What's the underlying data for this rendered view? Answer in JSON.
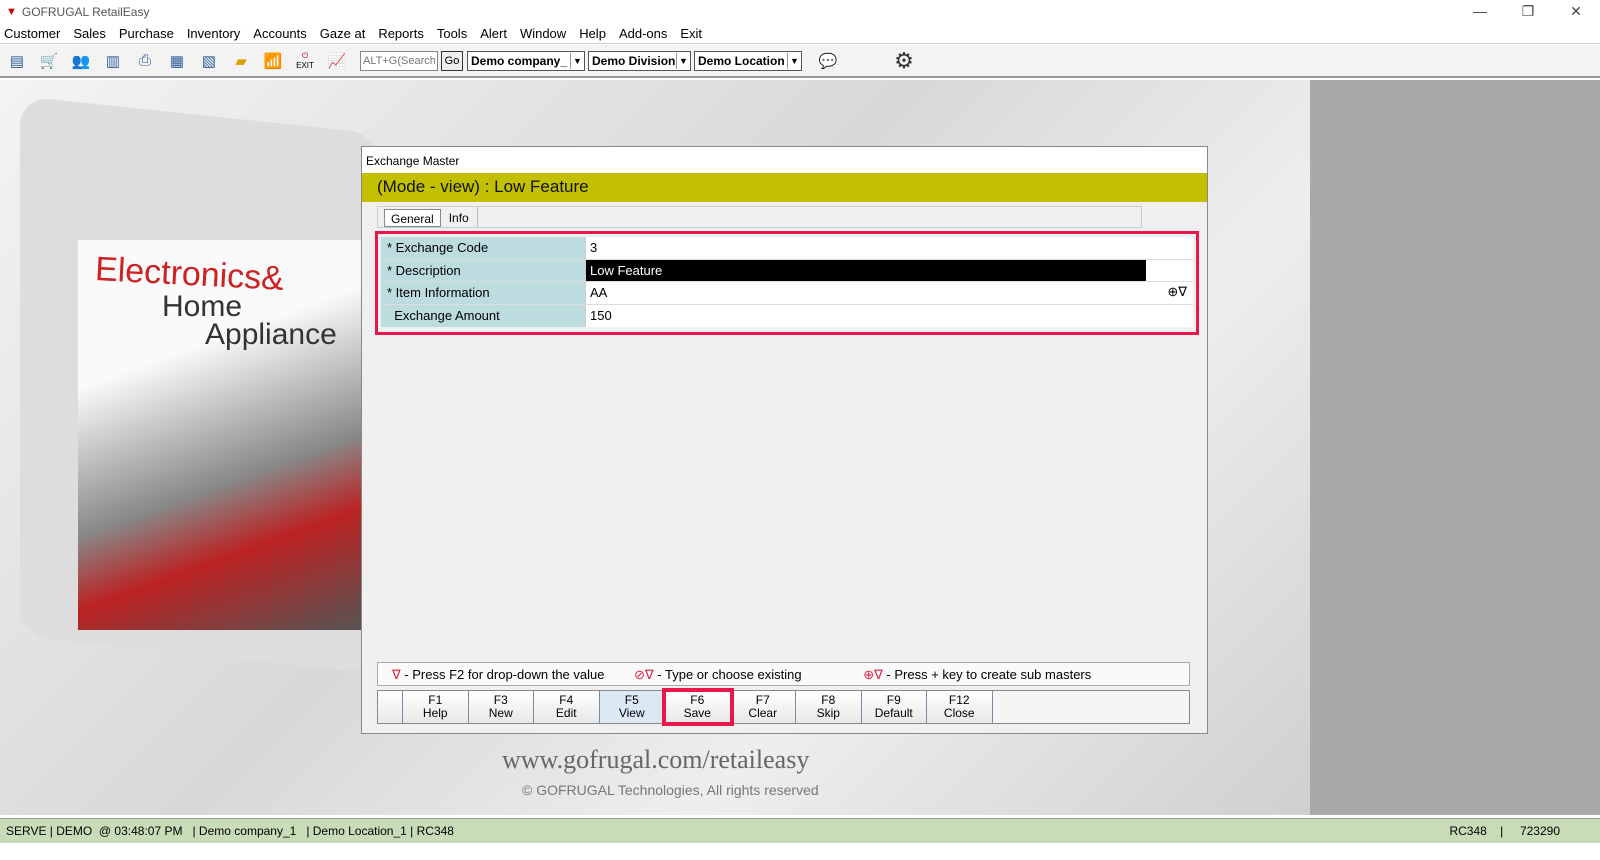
{
  "app": {
    "title": "GOFRUGAL RetailEasy",
    "min": "—",
    "restore": "❐",
    "close": "✕"
  },
  "menu": [
    "Customer",
    "Sales",
    "Purchase",
    "Inventory",
    "Accounts",
    "Gaze at",
    "Reports",
    "Tools",
    "Alert",
    "Window",
    "Help",
    "Add-ons",
    "Exit"
  ],
  "toolbar": {
    "search_placeholder": "ALT+G(Search",
    "go": "Go",
    "company": "Demo company_",
    "division": "Demo Division",
    "location": "Demo Location",
    "exit_label": "EXIT"
  },
  "dialog": {
    "title": "Exchange Master",
    "mode": "(Mode - view)  :  Low Feature",
    "tabs": [
      "General",
      "Info"
    ],
    "fields": [
      {
        "label": "* Exchange Code",
        "value": "3"
      },
      {
        "label": "* Description",
        "value": "Low Feature"
      },
      {
        "label": "* Item Information",
        "value": "AA"
      },
      {
        "label": "  Exchange Amount",
        "value": "150"
      }
    ],
    "legend": {
      "l1": "∇",
      "t1": " - Press F2 for drop-down the value",
      "l2": "⊘∇",
      "t2": " - Type or choose existing",
      "l3": "⊕∇",
      "t3": " - Press + key to create sub masters"
    },
    "fkeys": [
      {
        "k": "F1",
        "l": "Help"
      },
      {
        "k": "F3",
        "l": "New"
      },
      {
        "k": "F4",
        "l": "Edit"
      },
      {
        "k": "F5",
        "l": "View"
      },
      {
        "k": "F6",
        "l": "Save"
      },
      {
        "k": "F7",
        "l": "Clear"
      },
      {
        "k": "F8",
        "l": "Skip"
      },
      {
        "k": "F9",
        "l": "Default"
      },
      {
        "k": "F12",
        "l": "Close"
      }
    ]
  },
  "background": {
    "promo1": "Electronics&",
    "promo2": "Home",
    "promo3": "Appliance",
    "website": "www.gofrugal.com/retaileasy",
    "copyright": "© GOFRUGAL Technologies, All rights reserved"
  },
  "status": {
    "left": "SERVE | DEMO  @ 03:48:07 PM   | Demo company_1   | Demo Location_1 | RC348",
    "right": "RC348    |     723290"
  }
}
